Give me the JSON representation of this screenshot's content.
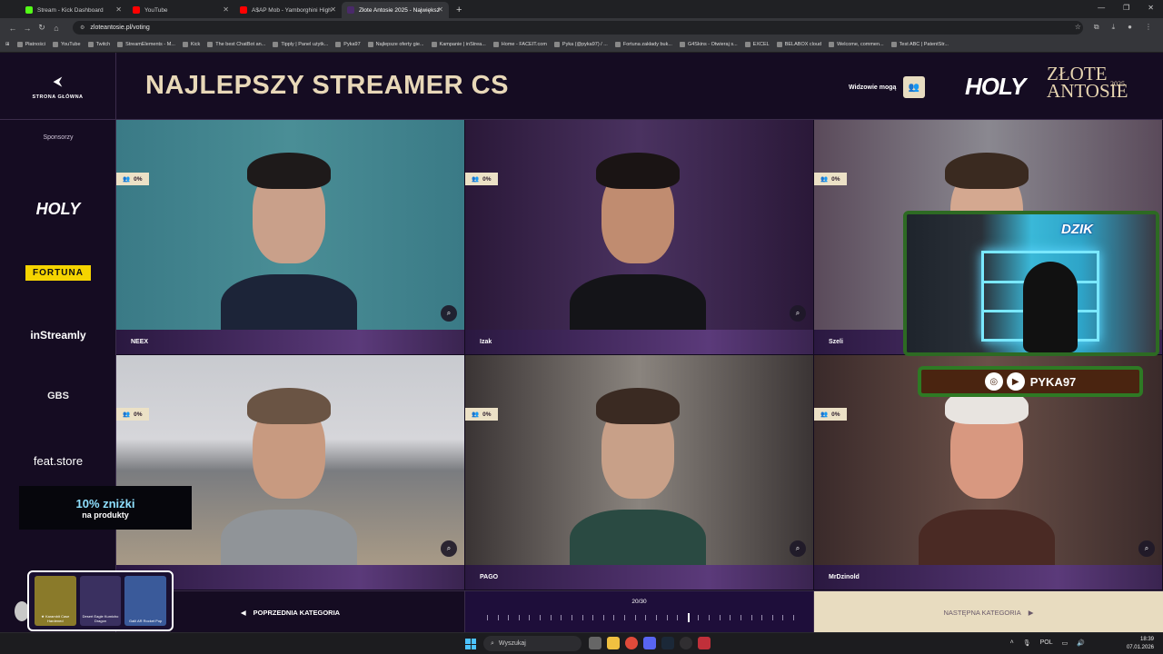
{
  "browser": {
    "tabs": [
      {
        "label": "Stream - Kick Dashboard",
        "fav": "#53fc18"
      },
      {
        "label": "YouTube",
        "fav": "#ff0000"
      },
      {
        "label": "A$AP Mob - Yamborghini High",
        "fav": "#ff0000"
      },
      {
        "label": "Złote Antosie 2025 - Największ",
        "fav": "#4a2a6a",
        "active": true
      }
    ],
    "new_tab": "+",
    "url": "zloteantosie.pl/voting",
    "bookmarks": [
      "Płatności",
      "YouTube",
      "Twitch",
      "StreamElements - M...",
      "Kick",
      "The best ChatBot an...",
      "Tipply | Panel użytk...",
      "Pyka97",
      "Najlepsze oferty gie...",
      "Kampanie | inStrea...",
      "Home - FACEIT.com",
      "Pyka (@pyka97) / ...",
      "Fortuna zakłady buk...",
      "G4Skins - Otwieraj s...",
      "EXCEL",
      "BELABOX cloud",
      "Welcome, commen...",
      "Test ABC | PatentStr..."
    ]
  },
  "header": {
    "home_label": "STRONA GŁÓWNA",
    "title": "NAJLEPSZY STREAMER CS",
    "viewers_label": "Widzowie mogą",
    "logo_holy": "HOLY",
    "logo_zlote_line1": "ZŁOTE",
    "logo_zlote_line2": "ANTOSIE",
    "logo_year": "2025"
  },
  "sidebar": {
    "sponsors_label": "Sponsorzy",
    "sponsors": [
      "HOLY",
      "FORTUNA",
      "inStreamly",
      "GBS",
      "feat.store"
    ]
  },
  "promo": {
    "line1": "10% zniżki",
    "line2": "na produkty"
  },
  "candidates": [
    {
      "name": "NEEX",
      "percent": "0%"
    },
    {
      "name": "Izak",
      "percent": "0%"
    },
    {
      "name": "Szeli",
      "percent": "0%"
    },
    {
      "name": "",
      "percent": "0%"
    },
    {
      "name": "PAGO",
      "percent": "0%"
    },
    {
      "name": "MrDzinold",
      "percent": "0%"
    }
  ],
  "navigation": {
    "prev_label": "POPRZEDNIA KATEGORIA",
    "next_label": "NASTĘPNA KATEGORIA",
    "progress_text": "20/30",
    "current": 20,
    "total": 30
  },
  "overlay": {
    "cam_brand": "DZIK",
    "social_handle": "PYKA97",
    "skins": [
      "★ Karambit Case Hardened",
      "Desert Eagle Kumicho Dragon",
      "Galil AR Rocket Pop"
    ]
  },
  "taskbar": {
    "search_placeholder": "Wyszukaj",
    "lang": "POL",
    "time": "18:39",
    "date": "07.01.2026"
  },
  "colors": {
    "bg": "#120a1e",
    "title": "#e8d8b8",
    "cream": "#e8dcc0",
    "accent_purple": "#5b3a7a"
  }
}
